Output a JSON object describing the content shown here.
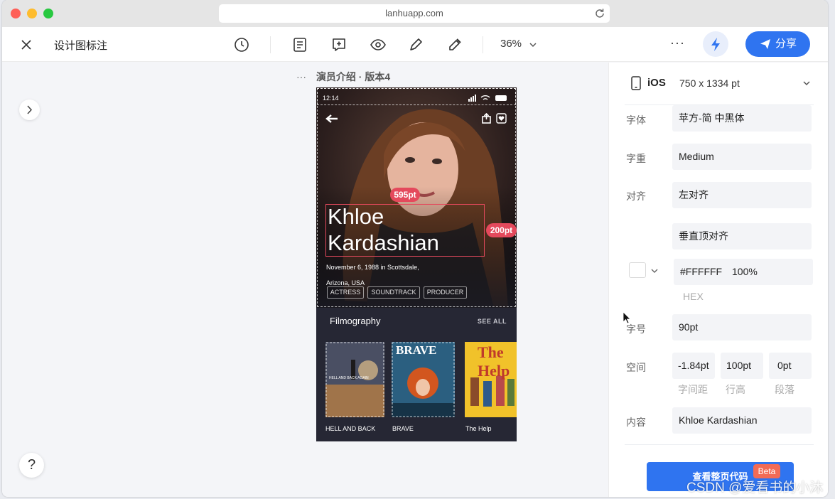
{
  "browser": {
    "url": "lanhuapp.com"
  },
  "toolbar": {
    "title": "设计图标注",
    "zoom": "36%",
    "more": "···",
    "share_label": "分享"
  },
  "canvas": {
    "artboard_dots": "···",
    "artboard_title": "演员介绍 · 版本4",
    "help": "?"
  },
  "phone": {
    "status_time": "12:14",
    "name": "Khloe Kardashian",
    "badge_top": "595pt",
    "badge_right": "200pt",
    "birth_line1": "November 6, 1988 in Scottsdale,",
    "birth_line2": "Arizona, USA",
    "tags": [
      "ACTRESS",
      "SOUNDTRACK",
      "PRODUCER"
    ],
    "filmography_title": "Filmography",
    "see_all": "SEE ALL",
    "posters": [
      {
        "label": "HELL AND BACK",
        "caption": "HELL AND BACK AGAIN"
      },
      {
        "label": "BRAVE",
        "caption": "BRAVE"
      },
      {
        "label": "The Help",
        "caption": "The Help"
      }
    ]
  },
  "panel": {
    "device_os": "iOS",
    "device_size": "750 x 1334 pt",
    "font_family_label": "字体",
    "font_family_value": "苹方-简 中黑体",
    "font_weight_label": "字重",
    "font_weight_value": "Medium",
    "align_label": "对齐",
    "align_value": "左对齐",
    "valign_value": "垂直顶对齐",
    "color_hex": "#FFFFFF",
    "color_opacity": "100%",
    "color_format": "HEX",
    "font_size_label": "字号",
    "font_size_value": "90pt",
    "spacing_label": "空间",
    "letter_spacing_value": "-1.84pt",
    "line_height_value": "100pt",
    "paragraph_value": "0pt",
    "letter_spacing_sub": "字间距",
    "line_height_sub": "行高",
    "paragraph_sub": "段落",
    "content_label": "内容",
    "content_value": "Khloe Kardashian",
    "code_button_label": "查看整页代码",
    "beta_label": "Beta"
  },
  "watermark": "CSDN @爱看书的小沐",
  "colors": {
    "accent": "#2f74f0",
    "annotation_red": "#e4495c",
    "beta": "#f26b56",
    "selected_text_color": "#ffffff"
  },
  "icons": {
    "toolbar": [
      "close-icon",
      "history-icon",
      "notes-icon",
      "comment-add-icon",
      "eye-icon",
      "pen-icon",
      "eyedropper-icon",
      "chevron-down-icon",
      "bolt-icon",
      "send-icon"
    ],
    "canvas": [
      "chevron-right-icon",
      "help-icon"
    ],
    "panel": [
      "phone-icon",
      "chevron-down-icon"
    ]
  }
}
